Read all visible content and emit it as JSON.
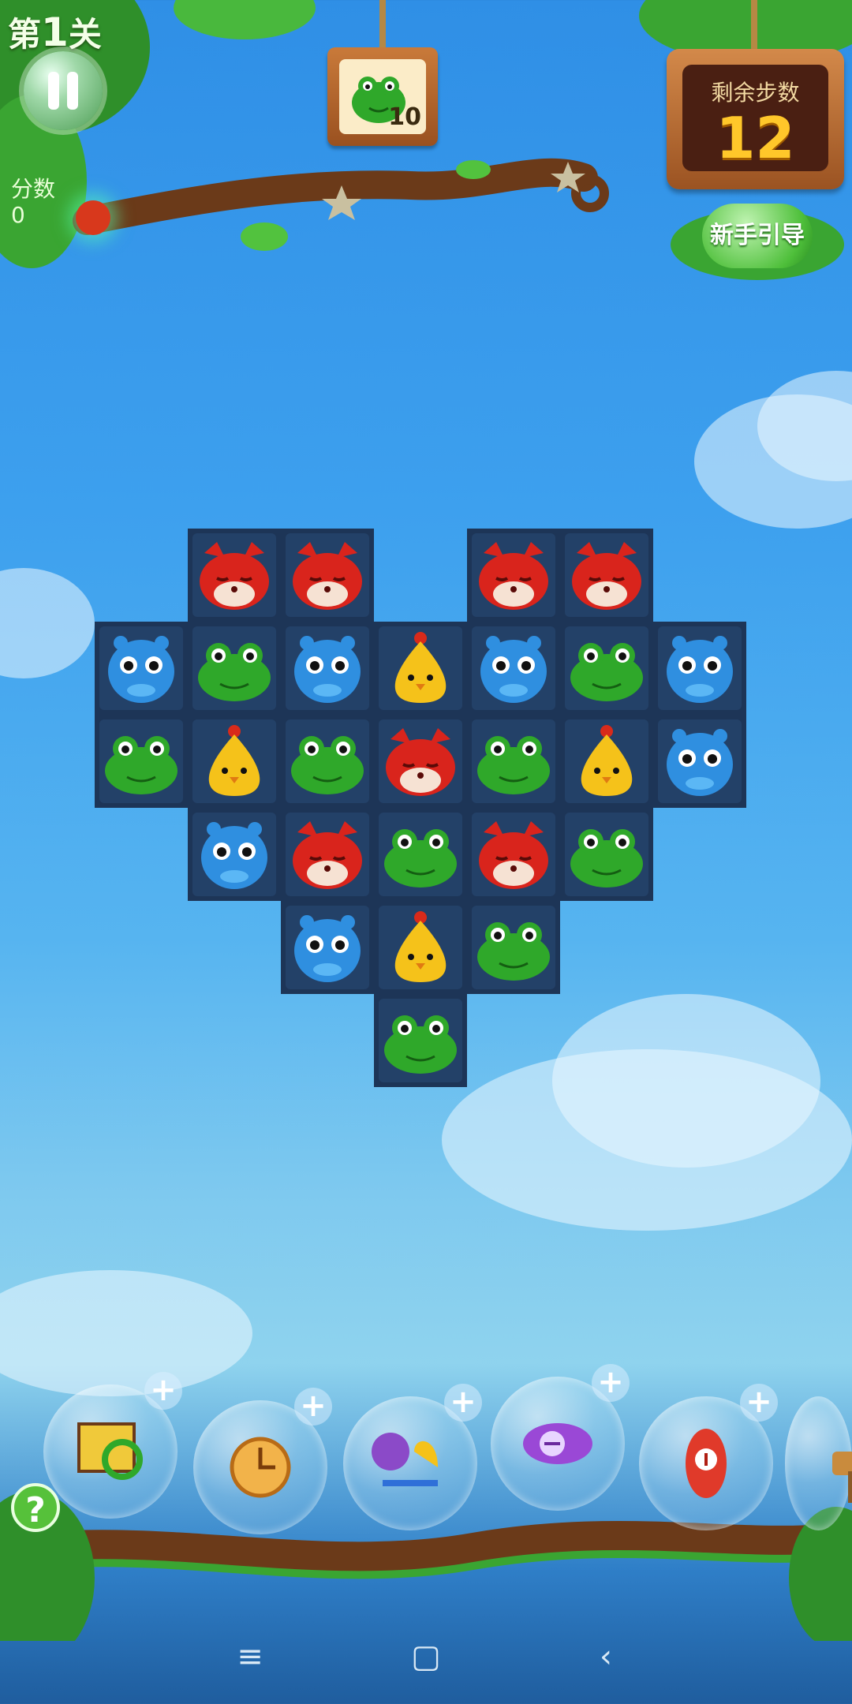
{
  "hud": {
    "level_prefix": "第",
    "level_number": "1",
    "level_suffix": "关",
    "score_label": "分数",
    "score_value": "0",
    "goal": {
      "icon": "frog-icon",
      "count": "10"
    },
    "moves_label": "剩余步数",
    "moves_value": "12",
    "guide_label": "新手引导"
  },
  "board": {
    "rows": [
      [
        "",
        "fox",
        "fox",
        "",
        "fox",
        "fox",
        ""
      ],
      [
        "hippo",
        "frog",
        "hippo",
        "chick",
        "hippo",
        "frog",
        "hippo"
      ],
      [
        "frog",
        "chick",
        "frog",
        "fox",
        "frog",
        "chick",
        "hippo"
      ],
      [
        "",
        "hippo",
        "fox",
        "frog",
        "fox",
        "frog",
        ""
      ],
      [
        "",
        "",
        "hippo",
        "chick",
        "frog",
        "",
        ""
      ],
      [
        "",
        "",
        "",
        "frog",
        "",
        "",
        ""
      ]
    ]
  },
  "boosters": [
    {
      "icon": "shuffle-grid-icon",
      "plus": "+"
    },
    {
      "icon": "clock-icon",
      "plus": "+"
    },
    {
      "icon": "swap-pieces-icon",
      "plus": "+"
    },
    {
      "icon": "horizontal-rocket-icon",
      "plus": "+"
    },
    {
      "icon": "vertical-rocket-icon",
      "plus": "+"
    },
    {
      "icon": "hammer-icon",
      "plus": ""
    }
  ],
  "help_label": "?",
  "nav": {
    "menu": "≡",
    "home": "▢",
    "back": "‹"
  },
  "colors": {
    "fox": "#d9241c",
    "hippo": "#2f8fe0",
    "frog": "#2fa82a",
    "chick": "#f5c21a"
  }
}
